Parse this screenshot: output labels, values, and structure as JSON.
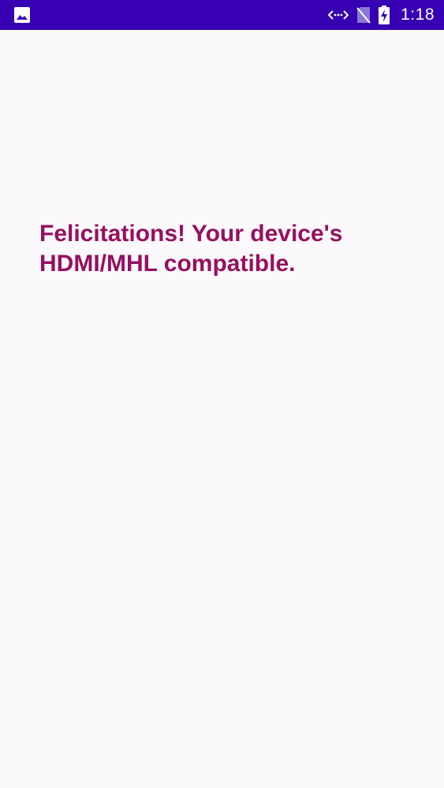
{
  "status_bar": {
    "time": "1:18",
    "icons": [
      "image-icon",
      "data-sync-icon",
      "no-sim-icon",
      "battery-charging-icon"
    ],
    "background": "#3700b3"
  },
  "main": {
    "message": "Felicitations! Your device's HDMI/MHL compatible.",
    "message_color": "#96105f",
    "background": "#fbf9fc"
  }
}
